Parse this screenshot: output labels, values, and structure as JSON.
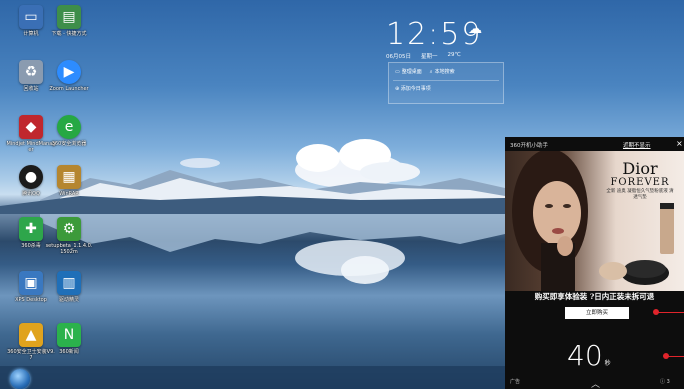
{
  "desktop": {
    "icons": [
      {
        "label": "计算机",
        "icon": "computer-icon",
        "color": "#3a6fb5"
      },
      {
        "label": "下载 - 快捷方式",
        "icon": "folder-shortcut-icon",
        "color": "#3e8e4a"
      },
      {
        "label": "回收站",
        "icon": "recycle-bin-icon",
        "color": "#8a9bb0"
      },
      {
        "label": "Zoom Launcher",
        "icon": "zoom-icon",
        "color": "#2d8cff"
      },
      {
        "label": "Mindjet MindManager",
        "icon": "mindmanager-icon",
        "color": "#c0272d"
      },
      {
        "label": "360安全浏览器",
        "icon": "browser-360-icon",
        "color": "#26a843"
      },
      {
        "label": "腾讯QQ",
        "icon": "qq-icon",
        "color": "#1b1b1b"
      },
      {
        "label": "WinRAR",
        "icon": "archive-icon",
        "color": "#b5862f"
      },
      {
        "label": "360杀毒",
        "icon": "antivirus-360-icon",
        "color": "#2ea64b"
      },
      {
        "label": "setupbeta_1.1.4.0.1502m",
        "icon": "setup-icon",
        "color": "#3c9a3a"
      },
      {
        "label": "XPS Desktop",
        "icon": "desktop-app-icon",
        "color": "#3a78c0"
      },
      {
        "label": "驱动精灵",
        "icon": "driver-icon",
        "color": "#1f6fb8"
      },
      {
        "label": "360安全卫士安装V9.7",
        "icon": "installer-icon",
        "color": "#e0a31d"
      },
      {
        "label": "360新闻",
        "icon": "news-360-icon",
        "color": "#2bb24c"
      }
    ]
  },
  "clock": {
    "time": "12:59",
    "weather_icon": "cloud-icon",
    "date": "06月05日",
    "weekday": "星期一",
    "temperature": "29℃",
    "links": [
      "整理桌面",
      "本地搜索"
    ],
    "todo": "添加今日事项"
  },
  "ad": {
    "title": "360开机小助手",
    "no_tip": "近期不显示",
    "close": "×",
    "brand": "Dior",
    "product": "FOREVER",
    "subtitle": "全新 迪奥 凝脂恒久气垫粉底液 清透气垫",
    "headline": "购买即享体验装 ?日内正装未拆可退",
    "buy_button": "立即购买",
    "countdown": "40",
    "countdown_unit": "秒",
    "tag": "广告",
    "chevron": "︿",
    "info": "ⓘ 3"
  }
}
